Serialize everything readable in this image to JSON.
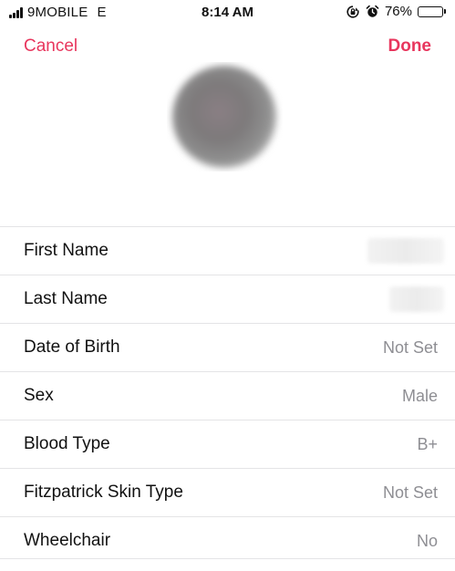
{
  "status_bar": {
    "carrier": "9MOBILE",
    "network": "E",
    "time": "8:14 AM",
    "battery_percent": "76%",
    "battery_level": 0.76,
    "icons": [
      "signal-bars-icon",
      "orientation-lock-icon",
      "alarm-clock-icon",
      "battery-icon"
    ]
  },
  "nav": {
    "cancel_label": "Cancel",
    "done_label": "Done",
    "accent_color": "#e8365d"
  },
  "profile": {
    "avatar": "profile-photo-blurred"
  },
  "details": [
    {
      "label": "First Name",
      "value": ""
    },
    {
      "label": "Last Name",
      "value": ""
    },
    {
      "label": "Date of Birth",
      "value": "Not Set"
    },
    {
      "label": "Sex",
      "value": "Male"
    },
    {
      "label": "Blood Type",
      "value": "B+"
    },
    {
      "label": "Fitzpatrick Skin Type",
      "value": "Not Set"
    },
    {
      "label": "Wheelchair",
      "value": "No"
    }
  ]
}
